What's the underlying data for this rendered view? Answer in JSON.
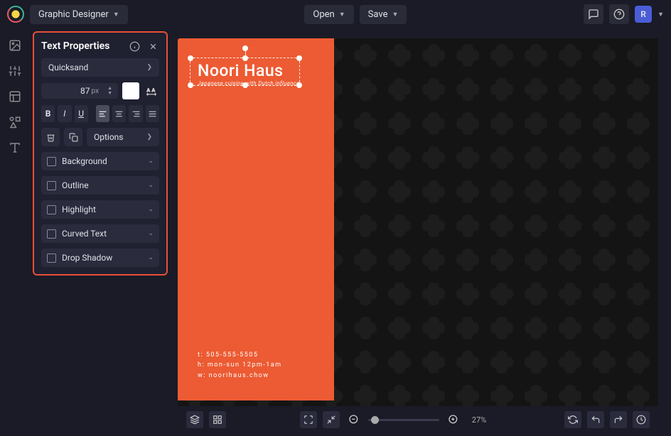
{
  "topbar": {
    "app_label": "Graphic Designer",
    "open_label": "Open",
    "save_label": "Save",
    "avatar_initial": "R"
  },
  "panel": {
    "title": "Text Properties",
    "font_family": "Quicksand",
    "font_size": "87",
    "font_size_unit": "px",
    "color": "#ffffff",
    "options_label": "Options",
    "accordions": [
      {
        "label": "Background",
        "checked": false
      },
      {
        "label": "Outline",
        "checked": false
      },
      {
        "label": "Highlight",
        "checked": false
      },
      {
        "label": "Curved Text",
        "checked": false
      },
      {
        "label": "Drop Shadow",
        "checked": false
      }
    ]
  },
  "canvas": {
    "title": "Noori Haus",
    "subtitle": "Japanese cuisine with Dutch influence.",
    "footer_phone": "t: 505-555-5505",
    "footer_hours": "h: mon-sun 12pm-1am",
    "footer_web": "w: noorihaus.chow",
    "accent_color": "#ec5b33"
  },
  "bottombar": {
    "zoom": "27%"
  }
}
